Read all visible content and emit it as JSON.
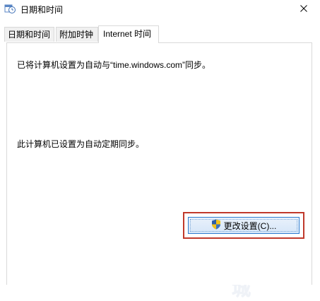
{
  "window": {
    "title": "日期和时间",
    "icon": "clock-calendar-icon",
    "close_glyph": "✕"
  },
  "tabs": [
    {
      "label": "日期和时间",
      "active": false
    },
    {
      "label": "附加时钟",
      "active": false
    },
    {
      "label": "Internet 时间",
      "active": true
    }
  ],
  "internet_time": {
    "sync_status": "已将计算机设置为自动与“time.windows.com”同步。",
    "schedule_status": "此计算机已设置为自动定期同步。",
    "change_button_label": "更改设置(C)...",
    "change_button_icon": "uac-shield-icon"
  },
  "annotation": {
    "highlight_color": "#c0392b"
  },
  "watermark": {
    "big_text": "电脑系统城",
    "url_text": "www.dnxtc.net"
  }
}
